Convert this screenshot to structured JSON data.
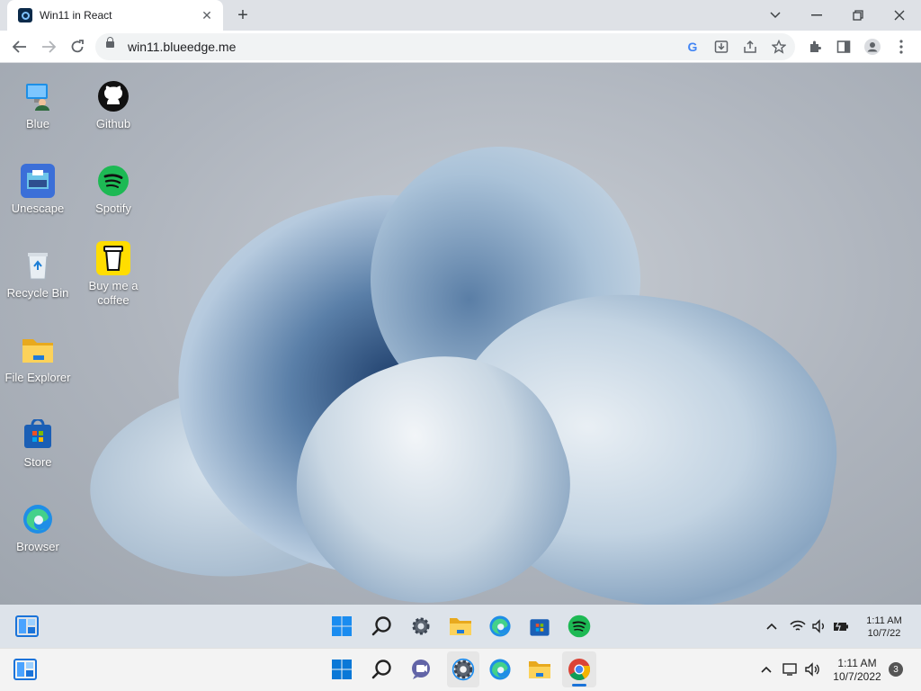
{
  "browser": {
    "tab_title": "Win11 in React",
    "url": "win11.blueedge.me"
  },
  "desktop": {
    "icons": [
      {
        "label": "Blue",
        "icon": "blue-user-pc-icon"
      },
      {
        "label": "Unescape",
        "icon": "unescape-icon"
      },
      {
        "label": "Recycle Bin",
        "icon": "recycle-bin-icon"
      },
      {
        "label": "File Explorer",
        "icon": "folder-icon"
      },
      {
        "label": "Store",
        "icon": "store-icon"
      },
      {
        "label": "Browser",
        "icon": "edge-icon"
      },
      {
        "label": "Github",
        "icon": "github-icon"
      },
      {
        "label": "Spotify",
        "icon": "spotify-icon"
      },
      {
        "label": "Buy me a coffee",
        "icon": "coffee-icon"
      }
    ]
  },
  "inner_taskbar": {
    "time": "1:11 AM",
    "date": "10/7/22"
  },
  "host_taskbar": {
    "time": "1:11 AM",
    "date": "10/7/2022",
    "notification_count": "3"
  },
  "colors": {
    "spotify": "#1db954",
    "coffee_bg": "#ffdd00",
    "edge_blue": "#1f8ee6",
    "folder": "#f7c23b",
    "windows_blue": "#0a78d7"
  }
}
